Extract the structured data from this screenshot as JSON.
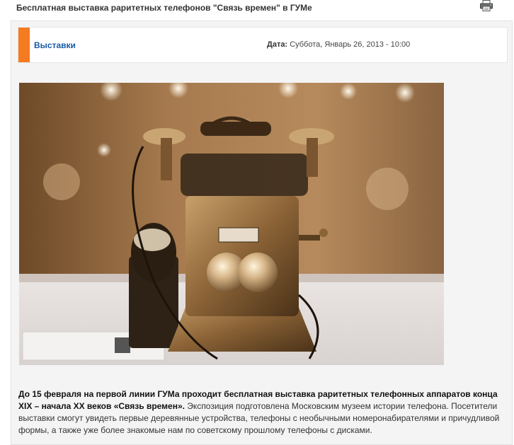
{
  "header": {
    "title": "Бесплатная выставка раритетных телефонов \"Связь времен\" в ГУМе",
    "print_icon": "printer-icon"
  },
  "meta": {
    "category": "Выставки",
    "date_label": "Дата:",
    "date_value": "Суббота, Январь 26, 2013 - 10:00",
    "accent_color": "#f47b20"
  },
  "article": {
    "lead": "До 15 февраля на первой линии ГУМа проходит бесплатная выставка раритетных телефонных аппаратов конца XIX – начала XX веков «Связь времен».",
    "body": " Экспозиция подготовлена Московским музеем истории телефона. Посетители выставки смогут увидеть первые деревянные устройства, телефоны с необычными номеронабирателями и причудливой формы, а также уже более знакомые нам по советскому прошлому телефоны с дисками."
  }
}
